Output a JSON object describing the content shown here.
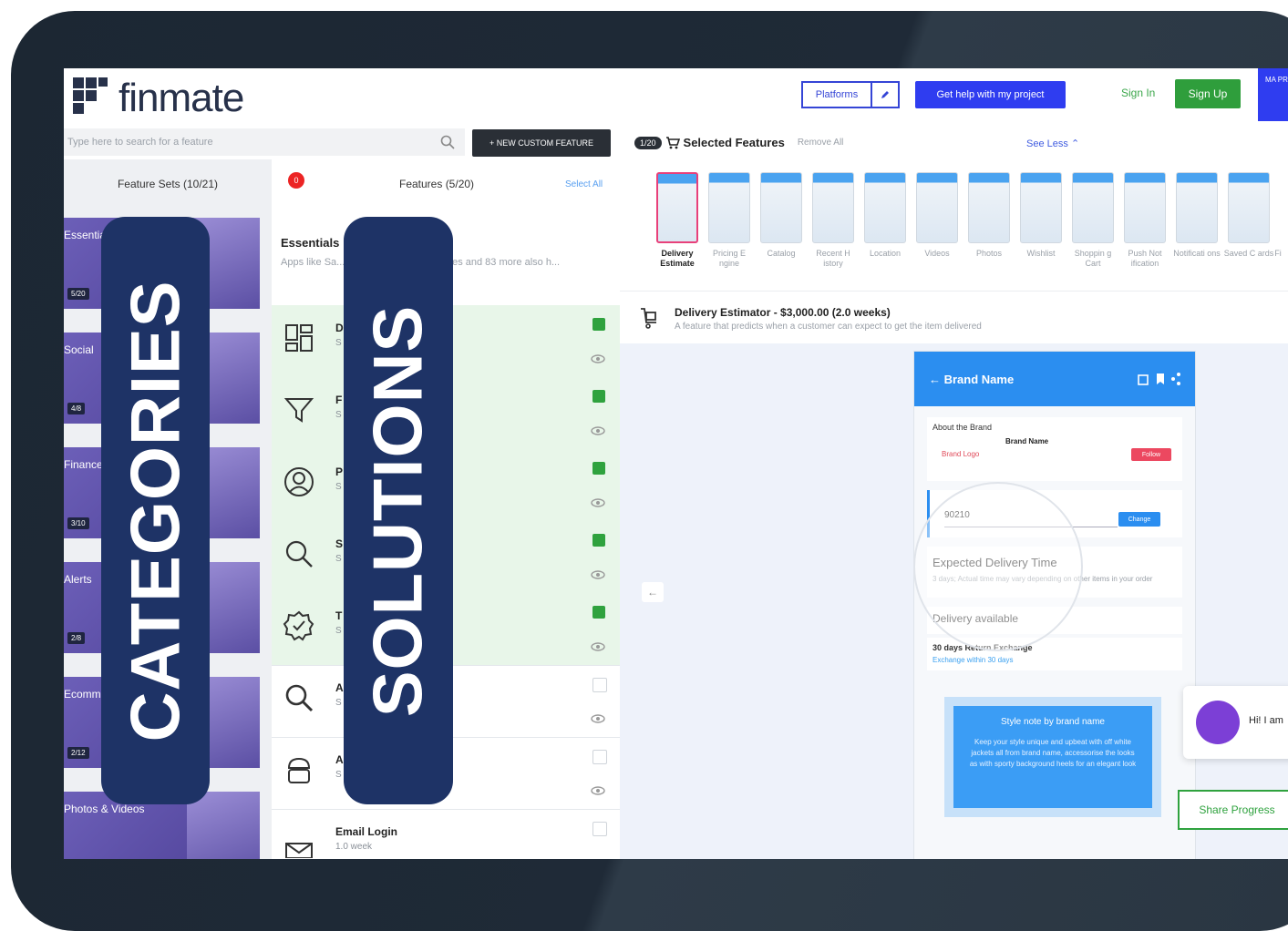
{
  "header": {
    "logo_text": "finmate",
    "platforms_label": "Platforms",
    "help_button": "Get help with my project",
    "sign_in": "Sign In",
    "sign_up": "Sign Up",
    "corner_label": "MA PR"
  },
  "search": {
    "placeholder": "Type here to search for a feature",
    "custom_feature_button": "+ NEW CUSTOM FEATURE"
  },
  "feature_sets": {
    "title": "Feature Sets (10/21)",
    "items": [
      {
        "label": "Essentials",
        "badge": "5/20"
      },
      {
        "label": "Social",
        "badge": "4/8"
      },
      {
        "label": "Finance",
        "badge": "3/10"
      },
      {
        "label": "Alerts",
        "badge": "2/8"
      },
      {
        "label": "Ecommerce",
        "badge": "2/12"
      },
      {
        "label": "Photos & Videos",
        "badge": ""
      }
    ]
  },
  "features": {
    "title": "Features (5/20)",
    "select_all": "Select All",
    "badge": "0",
    "essentials_title": "Essentials",
    "essentials_desc": "Apps like Sa... customer-facing Websites and 83 more also h...",
    "rows": [
      {
        "name": "D",
        "sub": "S",
        "checked": true,
        "icon": "dashboard-icon"
      },
      {
        "name": "F",
        "sub": "S",
        "checked": true,
        "icon": "filter-icon"
      },
      {
        "name": "P",
        "sub": "S",
        "checked": true,
        "icon": "profile-icon"
      },
      {
        "name": "S",
        "sub": "S",
        "checked": true,
        "icon": "search-icon"
      },
      {
        "name": "T   ation",
        "sub": "S",
        "checked": true,
        "icon": "verified-icon"
      },
      {
        "name": "A",
        "sub": "S",
        "checked": false,
        "icon": "magnifier-icon"
      },
      {
        "name": "A   w",
        "sub": "S",
        "checked": false,
        "icon": "android-icon"
      },
      {
        "name": "Email Login",
        "sub": "1.0 week",
        "checked": false,
        "icon": "mail-icon"
      }
    ]
  },
  "overlays": {
    "categories": "CATEGORIES",
    "solutions": "SOLUTIONS"
  },
  "selected": {
    "count": "1/20",
    "title": "Selected Features",
    "remove_all": "Remove All",
    "see_less": "See Less",
    "thumbs": [
      {
        "label": "Delivery Estimate",
        "active": true
      },
      {
        "label": "Pricing E ngine",
        "active": false
      },
      {
        "label": "Catalog",
        "active": false
      },
      {
        "label": "Recent H istory",
        "active": false
      },
      {
        "label": "Location",
        "active": false
      },
      {
        "label": "Videos",
        "active": false
      },
      {
        "label": "Photos",
        "active": false
      },
      {
        "label": "Wishlist",
        "active": false
      },
      {
        "label": "Shoppin g Cart",
        "active": false
      },
      {
        "label": "Push Not ification",
        "active": false
      },
      {
        "label": "Notificati ons",
        "active": false
      },
      {
        "label": "Saved C ards",
        "active": false
      },
      {
        "label": "Fi",
        "active": false
      }
    ]
  },
  "detail": {
    "title": "Delivery Estimator - $3,000.00 (2.0 weeks)",
    "desc": "A feature that predicts when a customer can expect to get the item delivered"
  },
  "preview": {
    "back_arrow": "←",
    "brand_bar": "←  Brand Name",
    "about_title": "About the Brand",
    "brand_logo": "Brand Logo",
    "brand_name": "Brand Name",
    "follow": "Follow",
    "zip": "90210",
    "zip_button": "Change",
    "edt_title": "Expected Delivery Time",
    "edt_desc": "3 days; Actual time may vary depending on other items in your order",
    "delivery_available": "Delivery available",
    "return_title": "30 days Return Exchange",
    "return_link": "Exchange within 30 days",
    "style_note_title": "Style note by brand name",
    "style_note_desc": "Keep your style unique and upbeat with off white jackets all from brand name, accessorise the looks as with sporty background heels for an elegant look",
    "chat_text": "Hi! I am",
    "share_progress": "Share Progress"
  }
}
